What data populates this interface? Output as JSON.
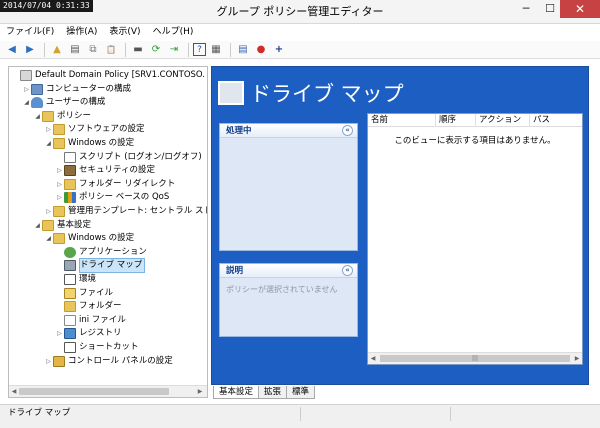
{
  "timestamp": "2014/07/04 0:31:33",
  "window": {
    "title": "グループ ポリシー管理エディター",
    "minimize": "─",
    "maximize": "☐",
    "close": "✕"
  },
  "menu": [
    "ファイル(F)",
    "操作(A)",
    "表示(V)",
    "ヘルプ(H)"
  ],
  "toolbar": {
    "back": "◀",
    "forward": "▶",
    "up": "▲",
    "show_hide": "▤",
    "copy": "⧉",
    "paste": "📋",
    "computer": "▬",
    "refresh": "⟳",
    "export": "⇥",
    "help": "?",
    "properties": "▦",
    "new_doc": "▤",
    "block": "●",
    "add": "+"
  },
  "tree": [
    {
      "label": "Default Domain Policy [SRV1.CONTOSO.",
      "icon": "policy",
      "indent": 0,
      "expand": ""
    },
    {
      "label": "コンピューターの構成",
      "icon": "computer",
      "indent": 1,
      "expand": "▷"
    },
    {
      "label": "ユーザーの構成",
      "icon": "user",
      "indent": 1,
      "expand": "◢"
    },
    {
      "label": "ポリシー",
      "icon": "folder",
      "indent": 2,
      "expand": "◢"
    },
    {
      "label": "ソフトウェアの設定",
      "icon": "folder",
      "indent": 3,
      "expand": "▷"
    },
    {
      "label": "Windows の設定",
      "icon": "folder",
      "indent": 3,
      "expand": "◢"
    },
    {
      "label": "スクリプト (ログオン/ログオフ)",
      "icon": "script",
      "indent": 4,
      "expand": ""
    },
    {
      "label": "セキュリティの設定",
      "icon": "security",
      "indent": 4,
      "expand": "▷"
    },
    {
      "label": "フォルダー リダイレクト",
      "icon": "folder",
      "indent": 4,
      "expand": "▷"
    },
    {
      "label": "ポリシー ベースの QoS",
      "icon": "qos",
      "indent": 4,
      "expand": "▷"
    },
    {
      "label": "管理用テンプレート: セントラル ストア(",
      "icon": "folder",
      "indent": 3,
      "expand": "▷"
    },
    {
      "label": "基本設定",
      "icon": "folder",
      "indent": 2,
      "expand": "◢"
    },
    {
      "label": "Windows の設定",
      "icon": "folder",
      "indent": 3,
      "expand": "◢"
    },
    {
      "label": "アプリケーション",
      "icon": "app",
      "indent": 4,
      "expand": ""
    },
    {
      "label": "ドライブ マップ",
      "icon": "drive",
      "indent": 4,
      "expand": "",
      "selected": true
    },
    {
      "label": "環境",
      "icon": "env",
      "indent": 4,
      "expand": ""
    },
    {
      "label": "ファイル",
      "icon": "file",
      "indent": 4,
      "expand": ""
    },
    {
      "label": "フォルダー",
      "icon": "folder",
      "indent": 4,
      "expand": ""
    },
    {
      "label": "ini ファイル",
      "icon": "ini",
      "indent": 4,
      "expand": ""
    },
    {
      "label": "レジストリ",
      "icon": "reg",
      "indent": 4,
      "expand": "▷"
    },
    {
      "label": "ショートカット",
      "icon": "shortcut",
      "indent": 4,
      "expand": ""
    },
    {
      "label": "コントロール パネルの設定",
      "icon": "cpanel",
      "indent": 3,
      "expand": "▷"
    }
  ],
  "scroll": {
    "left": "◀",
    "right": "▶",
    "thumb_grip": "|||"
  },
  "main": {
    "header_title": "ドライブ マップ",
    "processing": {
      "title": "処理中",
      "chevron": "«"
    },
    "description": {
      "title": "説明",
      "chevron": "«",
      "text": "ポリシーが選択されていません"
    },
    "columns": [
      "名前",
      "順序",
      "アクション",
      "パス"
    ],
    "empty_message": "このビューに表示する項目はありません。"
  },
  "tabs": [
    "基本設定",
    "拡張",
    "標準"
  ],
  "status": "ドライブ マップ"
}
